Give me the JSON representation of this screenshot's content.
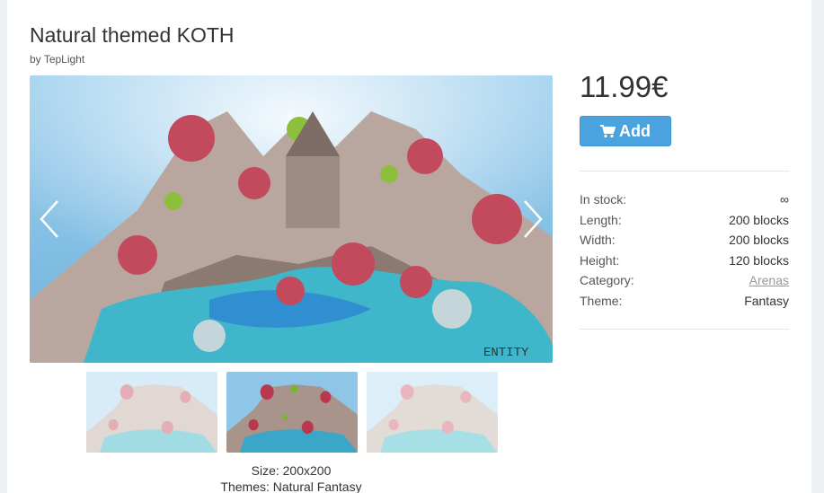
{
  "product": {
    "title": "Natural themed KOTH",
    "byline_prefix": "by",
    "author": "TepLight",
    "price": "11.99€",
    "add_label": "Add",
    "specs": [
      {
        "key": "In stock:",
        "value": "∞"
      },
      {
        "key": "Length:",
        "value": "200 blocks"
      },
      {
        "key": "Width:",
        "value": "200 blocks"
      },
      {
        "key": "Height:",
        "value": "120 blocks"
      },
      {
        "key": "Category:",
        "value": "Arenas"
      },
      {
        "key": "Theme:",
        "value": "Fantasy"
      }
    ],
    "size_label": "Size:",
    "size_value": "200x200",
    "themes_label": "Themes:",
    "themes_value": "Natural Fantasy",
    "watermark": "ENTITY"
  },
  "colors": {
    "accent_button": "#4aa3df",
    "sky": "#8fc6e8",
    "water": "#3aa7c9",
    "blossom": "#c24a5c",
    "rock": "#b8a39a"
  },
  "icons": {
    "prev": "chevron-left-icon",
    "next": "chevron-right-icon",
    "cart": "cart-icon"
  }
}
